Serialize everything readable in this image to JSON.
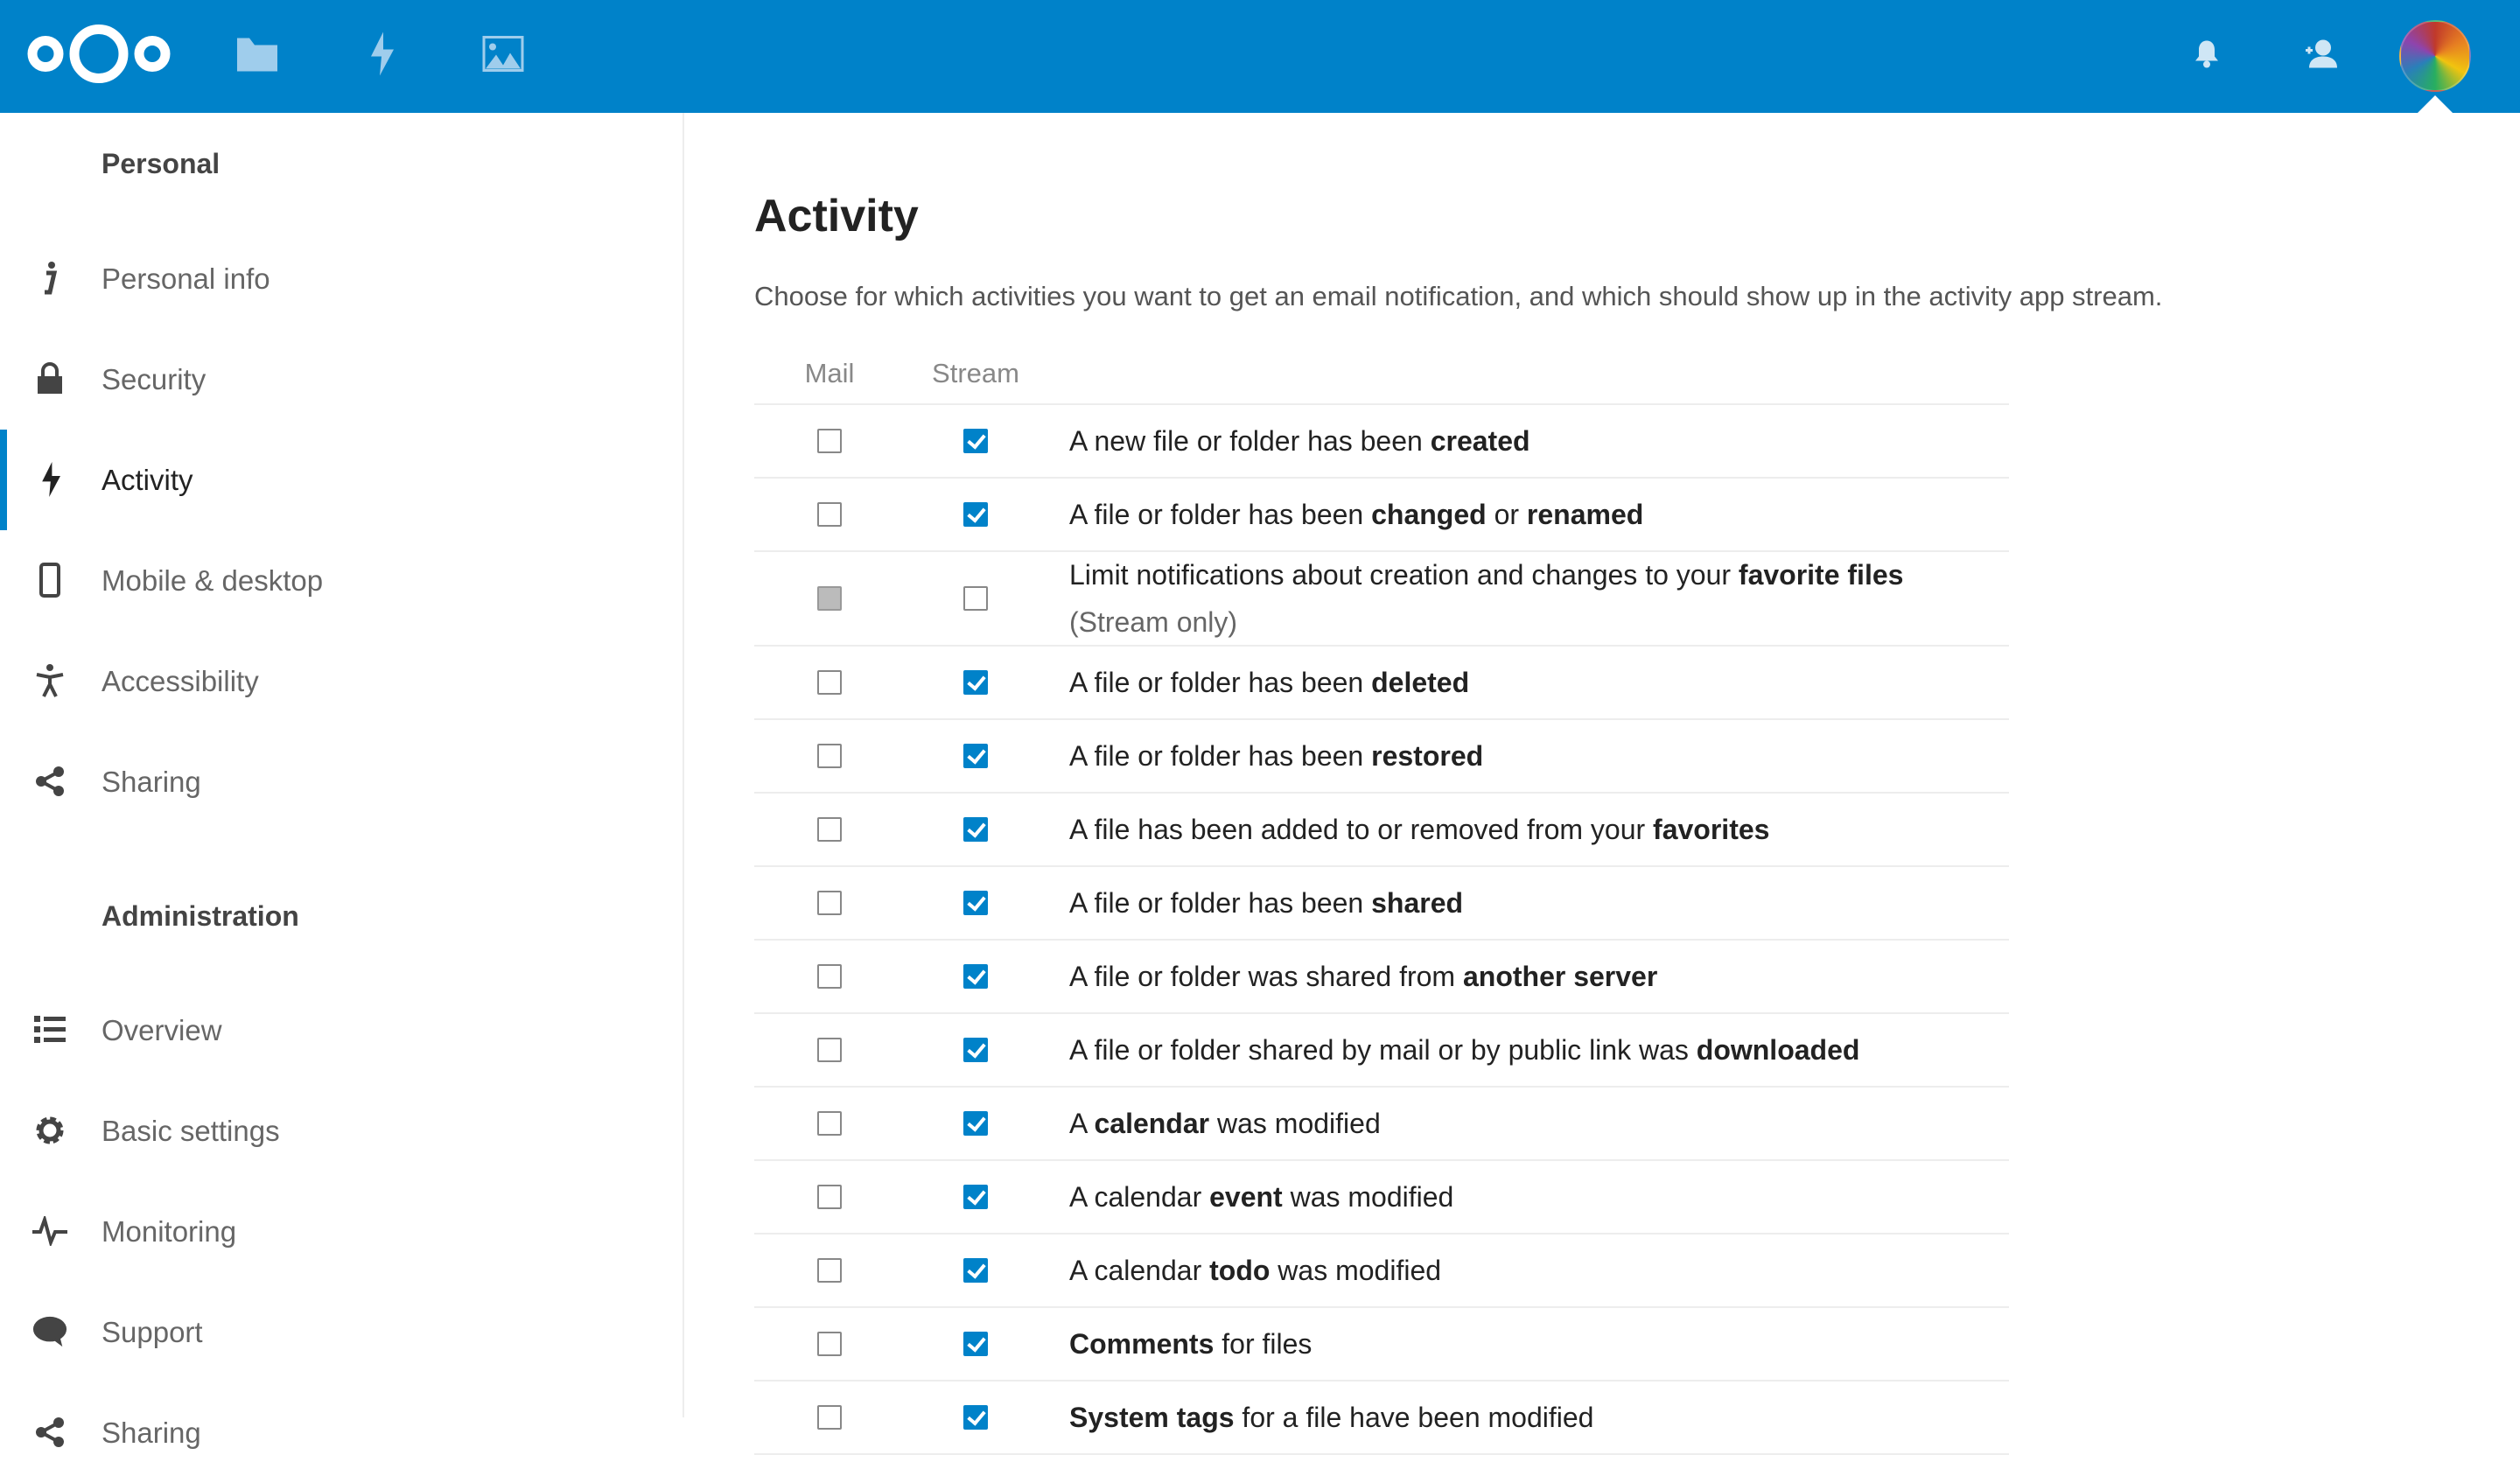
{
  "header": {
    "logo": "nextcloud-logo",
    "apps": [
      {
        "name": "files-icon"
      },
      {
        "name": "activity-icon"
      },
      {
        "name": "gallery-icon"
      }
    ],
    "right": [
      {
        "name": "bell-icon"
      },
      {
        "name": "contacts-icon"
      }
    ],
    "avatar": "user-avatar"
  },
  "colors": {
    "brand": "#0082c9"
  },
  "sidebar": {
    "personal_heading": "Personal",
    "personal": [
      {
        "label": "Personal info",
        "icon": "info-icon"
      },
      {
        "label": "Security",
        "icon": "lock-icon"
      },
      {
        "label": "Activity",
        "icon": "activity-icon",
        "active": true
      },
      {
        "label": "Mobile & desktop",
        "icon": "phone-icon"
      },
      {
        "label": "Accessibility",
        "icon": "accessibility-icon"
      },
      {
        "label": "Sharing",
        "icon": "share-icon"
      }
    ],
    "admin_heading": "Administration",
    "admin": [
      {
        "label": "Overview",
        "icon": "list-icon"
      },
      {
        "label": "Basic settings",
        "icon": "gear-icon"
      },
      {
        "label": "Monitoring",
        "icon": "pulse-icon"
      },
      {
        "label": "Support",
        "icon": "chat-icon"
      },
      {
        "label": "Sharing",
        "icon": "share-icon"
      }
    ]
  },
  "main": {
    "title": "Activity",
    "description": "Choose for which activities you want to get an email notification, and which should show up in the activity app stream.",
    "col_mail": "Mail",
    "col_stream": "Stream",
    "rows": [
      {
        "mail": false,
        "stream": true,
        "text": [
          {
            "t": "A new file or folder has been "
          },
          {
            "t": "created",
            "b": true
          }
        ]
      },
      {
        "mail": false,
        "stream": true,
        "text": [
          {
            "t": "A file or folder has been "
          },
          {
            "t": "changed",
            "b": true
          },
          {
            "t": " or "
          },
          {
            "t": "renamed",
            "b": true
          }
        ]
      },
      {
        "mail": "disabled",
        "stream": false,
        "tall": true,
        "text": [
          {
            "t": "Limit notifications about creation and changes to your "
          },
          {
            "t": "favorite files",
            "b": true
          }
        ],
        "sub": "(Stream only)"
      },
      {
        "mail": false,
        "stream": true,
        "text": [
          {
            "t": "A file or folder has been "
          },
          {
            "t": "deleted",
            "b": true
          }
        ]
      },
      {
        "mail": false,
        "stream": true,
        "text": [
          {
            "t": "A file or folder has been "
          },
          {
            "t": "restored",
            "b": true
          }
        ]
      },
      {
        "mail": false,
        "stream": true,
        "text": [
          {
            "t": "A file has been added to or removed from your "
          },
          {
            "t": "favorites",
            "b": true
          }
        ]
      },
      {
        "mail": false,
        "stream": true,
        "text": [
          {
            "t": "A file or folder has been "
          },
          {
            "t": "shared",
            "b": true
          }
        ]
      },
      {
        "mail": false,
        "stream": true,
        "text": [
          {
            "t": "A file or folder was shared from "
          },
          {
            "t": "another server",
            "b": true
          }
        ]
      },
      {
        "mail": false,
        "stream": true,
        "text": [
          {
            "t": "A file or folder shared by mail or by public link was "
          },
          {
            "t": "downloaded",
            "b": true
          }
        ]
      },
      {
        "mail": false,
        "stream": true,
        "text": [
          {
            "t": "A "
          },
          {
            "t": "calendar",
            "b": true
          },
          {
            "t": " was modified"
          }
        ]
      },
      {
        "mail": false,
        "stream": true,
        "text": [
          {
            "t": "A calendar "
          },
          {
            "t": "event",
            "b": true
          },
          {
            "t": " was modified"
          }
        ]
      },
      {
        "mail": false,
        "stream": true,
        "text": [
          {
            "t": "A calendar "
          },
          {
            "t": "todo",
            "b": true
          },
          {
            "t": " was modified"
          }
        ]
      },
      {
        "mail": false,
        "stream": true,
        "text": [
          {
            "t": "Comments",
            "b": true
          },
          {
            "t": " for files"
          }
        ]
      },
      {
        "mail": false,
        "stream": true,
        "text": [
          {
            "t": "System tags",
            "b": true
          },
          {
            "t": " for a file have been modified"
          }
        ]
      }
    ]
  }
}
